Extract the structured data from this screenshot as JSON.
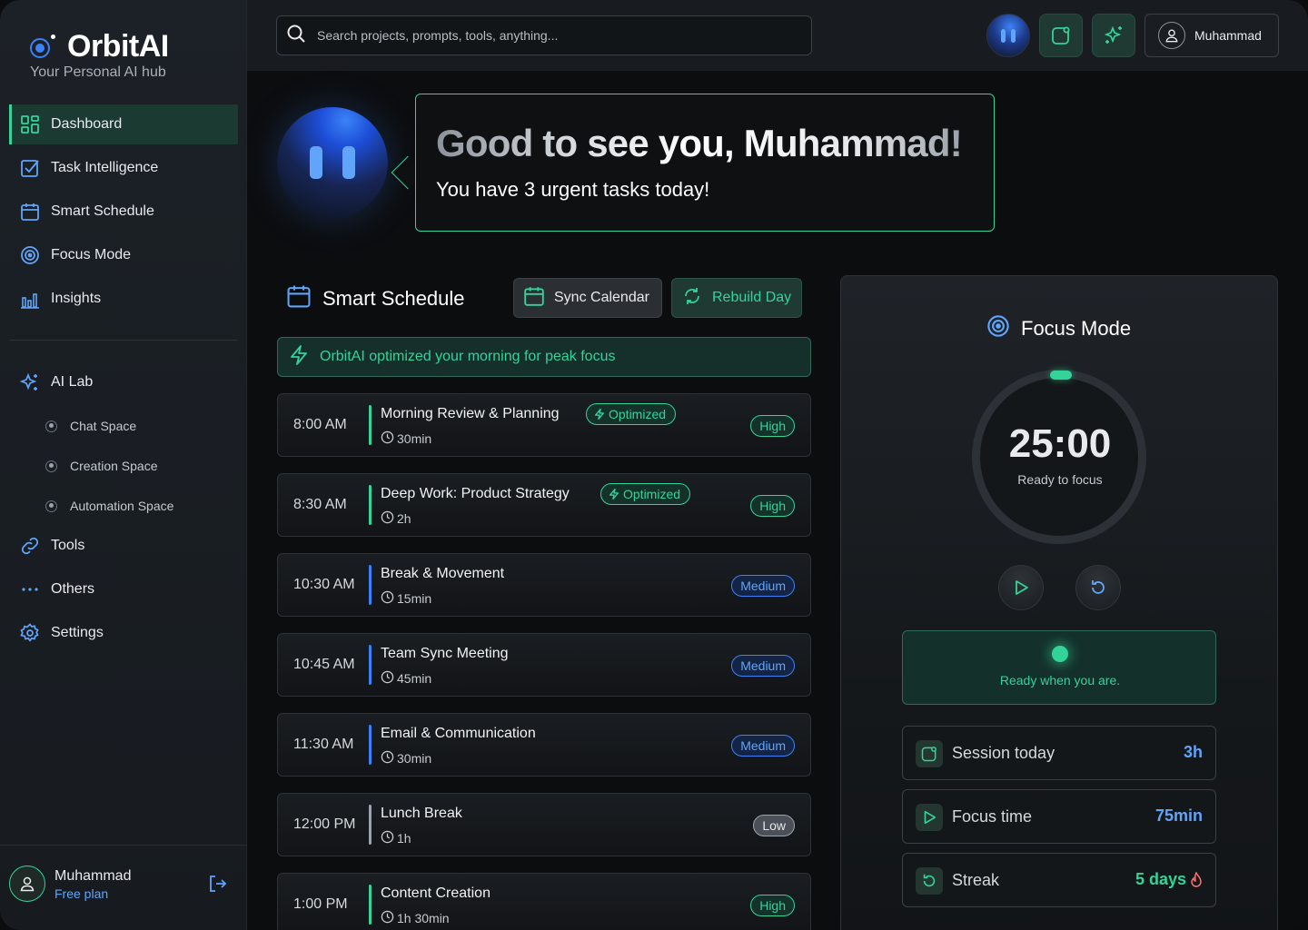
{
  "brand": {
    "name": "OrbitAI",
    "tagline": "Your Personal AI hub"
  },
  "nav": {
    "items": [
      {
        "label": "Dashboard",
        "icon": "grid-icon",
        "active": true
      },
      {
        "label": "Task Intelligence",
        "icon": "checkbox-icon"
      },
      {
        "label": "Smart Schedule",
        "icon": "calendar-icon"
      },
      {
        "label": "Focus Mode",
        "icon": "target-icon"
      },
      {
        "label": "Insights",
        "icon": "bar-chart-icon"
      }
    ],
    "ai_lab": {
      "label": "AI Lab",
      "icon": "sparkle-icon",
      "subitems": [
        "Chat Space",
        "Creation Space",
        "Automation Space"
      ]
    },
    "tools": "Tools",
    "others": "Others",
    "settings": "Settings"
  },
  "user": {
    "name": "Muhammad",
    "plan": "Free plan"
  },
  "search": {
    "placeholder": "Search projects, prompts, tools, anything..."
  },
  "topbar": {
    "user_label": "Muhammad"
  },
  "greeting": {
    "title": "Good to see you, Muhammad!",
    "subtitle": "You have 3 urgent tasks today!"
  },
  "schedule": {
    "title": "Smart Schedule",
    "sync_label": "Sync Calendar",
    "rebuild_label": "Rebuild Day",
    "banner": "OrbitAI optimized your morning for peak focus",
    "tasks": [
      {
        "time": "8:00 AM",
        "title": "Morning Review & Planning",
        "duration": "30min",
        "optimized": "Optimized",
        "priority": "High"
      },
      {
        "time": "8:30 AM",
        "title": "Deep Work: Product Strategy",
        "duration": "2h",
        "optimized": "Optimized",
        "priority": "High"
      },
      {
        "time": "10:30 AM",
        "title": "Break & Movement",
        "duration": "15min",
        "priority": "Medium"
      },
      {
        "time": "10:45 AM",
        "title": "Team Sync Meeting",
        "duration": "45min",
        "priority": "Medium"
      },
      {
        "time": "11:30 AM",
        "title": "Email & Communication",
        "duration": "30min",
        "priority": "Medium"
      },
      {
        "time": "12:00 PM",
        "title": "Lunch Break",
        "duration": "1h",
        "priority": "Low"
      },
      {
        "time": "1:00 PM",
        "title": "Content Creation",
        "duration": "1h 30min",
        "priority": "High"
      }
    ]
  },
  "focus": {
    "title": "Focus Mode",
    "timer": "25:00",
    "timer_status": "Ready to focus",
    "ready_text": "Ready when you are.",
    "stats": [
      {
        "label": "Session today",
        "value": "3h",
        "color": "#60a5fa",
        "icon": "session-icon"
      },
      {
        "label": "Focus time",
        "value": "75min",
        "color": "#60a5fa",
        "icon": "play-icon"
      },
      {
        "label": "Streak",
        "value": "5 days",
        "color": "#34d399",
        "icon": "refresh-icon"
      }
    ]
  },
  "colors": {
    "accent": "#34d399",
    "blue": "#3b82f6"
  }
}
